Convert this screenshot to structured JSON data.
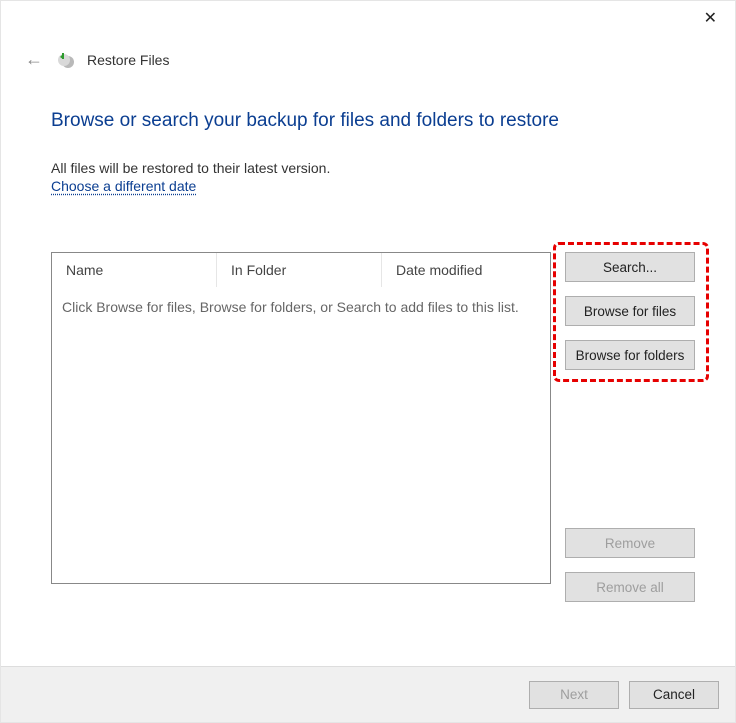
{
  "window": {
    "title": "Restore Files"
  },
  "heading": "Browse or search your backup for files and folders to restore",
  "subtext": "All files will be restored to their latest version.",
  "link_choose_date": "Choose a different date",
  "columns": {
    "name": "Name",
    "folder": "In Folder",
    "date": "Date modified"
  },
  "list_placeholder": "Click Browse for files, Browse for folders, or Search to add files to this list.",
  "buttons": {
    "search": "Search...",
    "browse_files": "Browse for files",
    "browse_folders": "Browse for folders",
    "remove": "Remove",
    "remove_all": "Remove all",
    "next": "Next",
    "cancel": "Cancel"
  }
}
